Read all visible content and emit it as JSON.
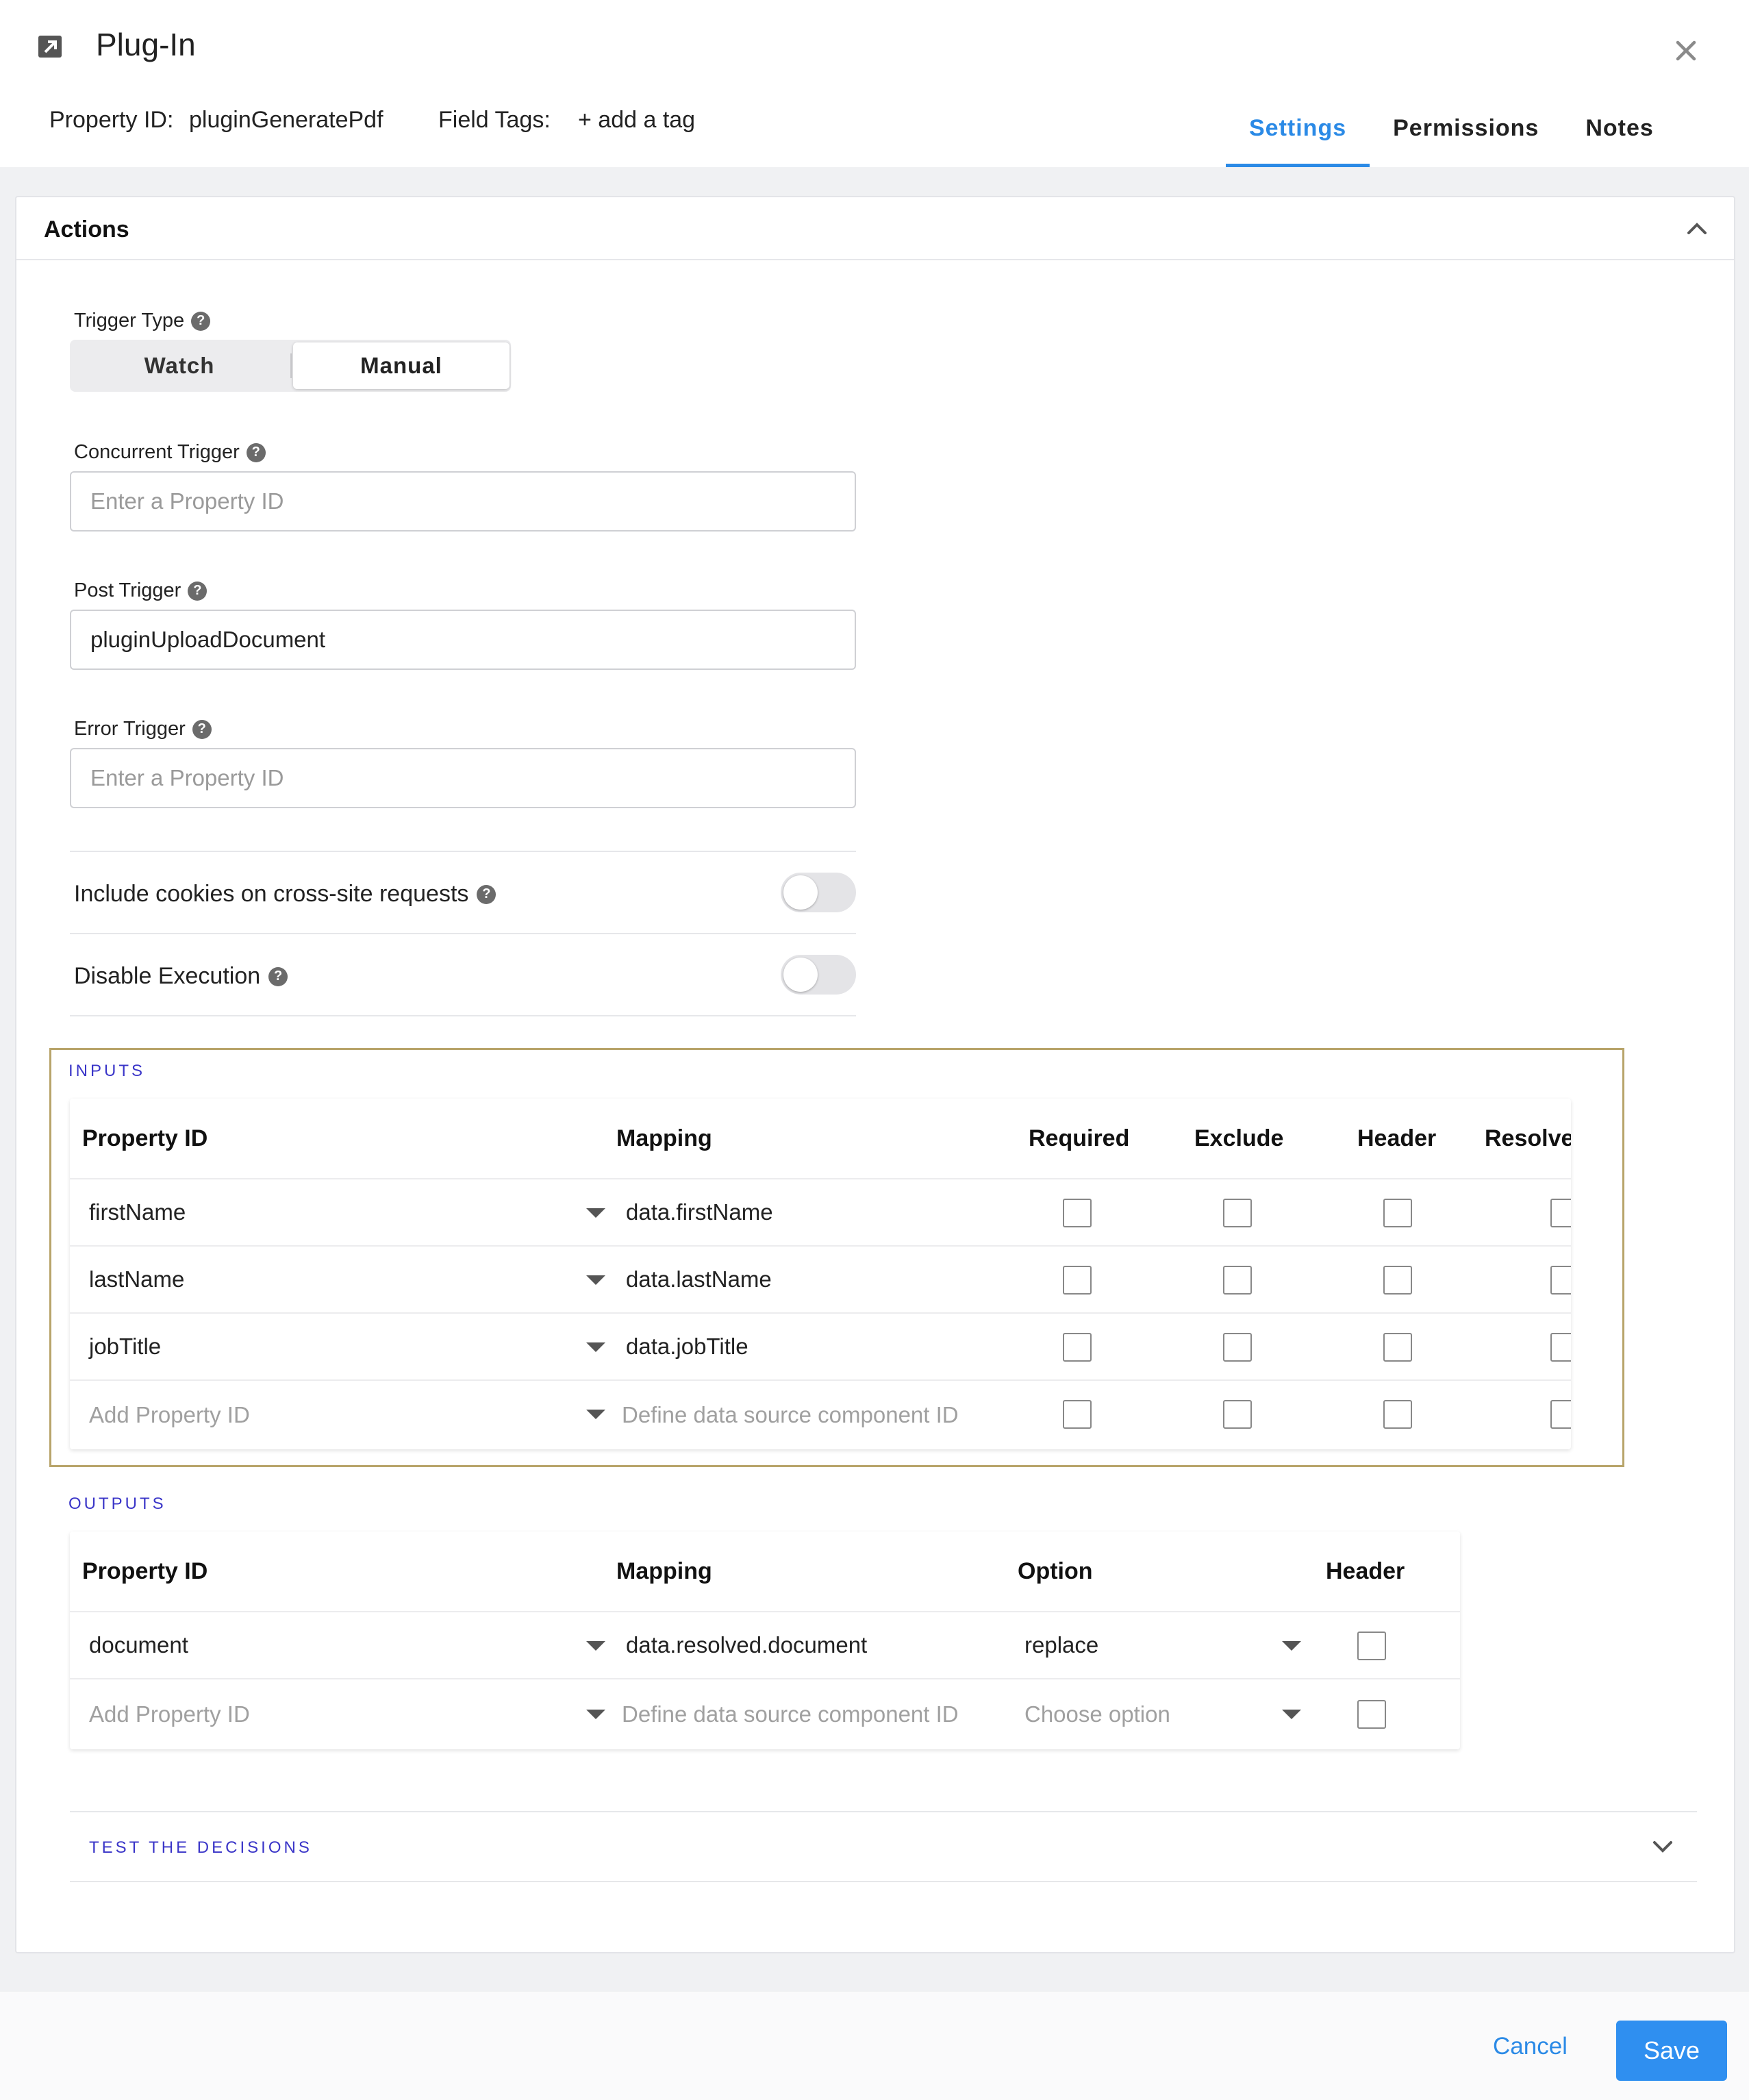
{
  "header": {
    "title": "Plug-In",
    "property_id_label": "Property ID:",
    "property_id_value": "pluginGeneratePdf",
    "field_tags_label": "Field Tags:",
    "add_tag": "+ add a tag",
    "tabs": [
      {
        "label": "Settings",
        "active": true
      },
      {
        "label": "Permissions",
        "active": false
      },
      {
        "label": "Notes",
        "active": false
      }
    ]
  },
  "panel": {
    "title": "Actions",
    "trigger_type": {
      "label": "Trigger Type",
      "options": [
        "Watch",
        "Manual"
      ],
      "selected": "Manual"
    },
    "concurrent_trigger": {
      "label": "Concurrent Trigger",
      "value": "",
      "placeholder": "Enter a Property ID"
    },
    "post_trigger": {
      "label": "Post Trigger",
      "value": "pluginUploadDocument",
      "placeholder": ""
    },
    "error_trigger": {
      "label": "Error Trigger",
      "value": "",
      "placeholder": "Enter a Property ID"
    },
    "include_cookies": {
      "label": "Include cookies on cross-site requests",
      "on": false
    },
    "disable_execution": {
      "label": "Disable Execution",
      "on": false
    }
  },
  "inputs": {
    "section_label": "INPUTS",
    "columns": [
      "Property ID",
      "Mapping",
      "Required",
      "Exclude",
      "Header",
      "Resolve"
    ],
    "rows": [
      {
        "property_id": "firstName",
        "mapping": "data.firstName"
      },
      {
        "property_id": "lastName",
        "mapping": "data.lastName"
      },
      {
        "property_id": "jobTitle",
        "mapping": "data.jobTitle"
      }
    ],
    "add_row": {
      "property_id_placeholder": "Add Property ID",
      "mapping_placeholder": "Define data source component ID"
    }
  },
  "outputs": {
    "section_label": "OUTPUTS",
    "columns": [
      "Property ID",
      "Mapping",
      "Option",
      "Header"
    ],
    "rows": [
      {
        "property_id": "document",
        "mapping": "data.resolved.document",
        "option": "replace"
      }
    ],
    "add_row": {
      "property_id_placeholder": "Add Property ID",
      "mapping_placeholder": "Define data source component ID",
      "option_placeholder": "Choose option"
    }
  },
  "test_decisions": {
    "label": "TEST THE DECISIONS"
  },
  "footer": {
    "cancel_label": "Cancel",
    "save_label": "Save"
  },
  "colors": {
    "accent": "#2b8ae6",
    "section_label": "#3a35c8",
    "inputs_highlight": "#b8a46a"
  }
}
